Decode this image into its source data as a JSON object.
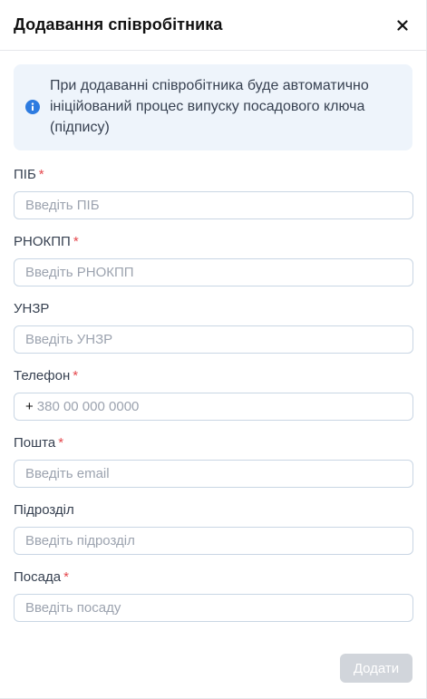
{
  "modal": {
    "title": "Додавання співробітника",
    "close_icon": "close-icon"
  },
  "info": {
    "icon": "info-icon",
    "text": "При додаванні співробітника буде автоматично ініційований процес випуску посадового ключа (підпису)"
  },
  "fields": {
    "pib": {
      "label": "ПІБ",
      "required": "*",
      "placeholder": "Введіть ПІБ"
    },
    "rnokpp": {
      "label": "РНОКПП",
      "required": "*",
      "placeholder": "Введіть РНОКПП"
    },
    "unzr": {
      "label": "УНЗР",
      "placeholder": "Введіть УНЗР"
    },
    "phone": {
      "label": "Телефон",
      "required": "*",
      "prefix": "+",
      "placeholder": "380 00 000 0000"
    },
    "email": {
      "label": "Пошта",
      "required": "*",
      "placeholder": "Введіть email"
    },
    "department": {
      "label": "Підрозділ",
      "placeholder": "Введіть підрозділ"
    },
    "position": {
      "label": "Посада",
      "required": "*",
      "placeholder": "Введіть посаду"
    }
  },
  "footer": {
    "submit_label": "Додати"
  },
  "colors": {
    "accent": "#2d7be0",
    "required": "#e5484d",
    "info_bg": "#eef4fb",
    "disabled_button": "#d1d5db"
  }
}
